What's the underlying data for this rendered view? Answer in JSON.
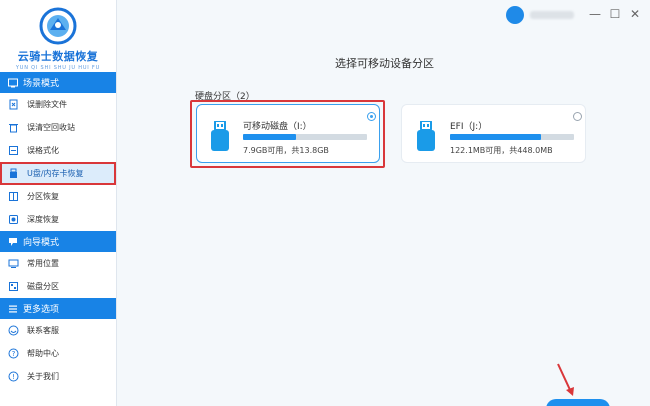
{
  "app": {
    "title": "云骑士数据恢复",
    "subtitle": "YUN QI SHI SHU JU HUI FU"
  },
  "sidebar": {
    "sections": [
      {
        "header": "场景模式",
        "items": [
          {
            "label": "误删除文件",
            "icon": "file-delete-icon"
          },
          {
            "label": "误清空回收站",
            "icon": "recycle-bin-icon"
          },
          {
            "label": "误格式化",
            "icon": "format-icon"
          },
          {
            "label": "U盘/内存卡恢复",
            "icon": "usb-drive-icon",
            "active": true
          },
          {
            "label": "分区恢复",
            "icon": "partition-icon"
          },
          {
            "label": "深度恢复",
            "icon": "deep-scan-icon"
          }
        ]
      },
      {
        "header": "向导模式",
        "items": [
          {
            "label": "常用位置",
            "icon": "common-location-icon"
          },
          {
            "label": "磁盘分区",
            "icon": "disk-partition-icon"
          }
        ]
      },
      {
        "header": "更多选项",
        "items": [
          {
            "label": "联系客服",
            "icon": "customer-service-icon"
          },
          {
            "label": "帮助中心",
            "icon": "help-icon"
          },
          {
            "label": "关于我们",
            "icon": "info-icon"
          }
        ]
      }
    ]
  },
  "window": {
    "minimize": "—",
    "maximize": "☐",
    "close": "✕"
  },
  "main": {
    "title": "选择可移动设备分区",
    "section_label": "硬盘分区（2）",
    "drives": [
      {
        "name": "可移动磁盘（I:）",
        "usage": "7.9GB可用，共13.8GB",
        "used_fraction": 0.43,
        "selected": true
      },
      {
        "name": "EFI（J:）",
        "usage": "122.1MB可用，共448.0MB",
        "used_fraction": 0.73,
        "selected": false
      }
    ]
  },
  "colors": {
    "accent": "#1e90ee",
    "sidebar_header": "#1883e6",
    "highlight": "#d9373a"
  }
}
